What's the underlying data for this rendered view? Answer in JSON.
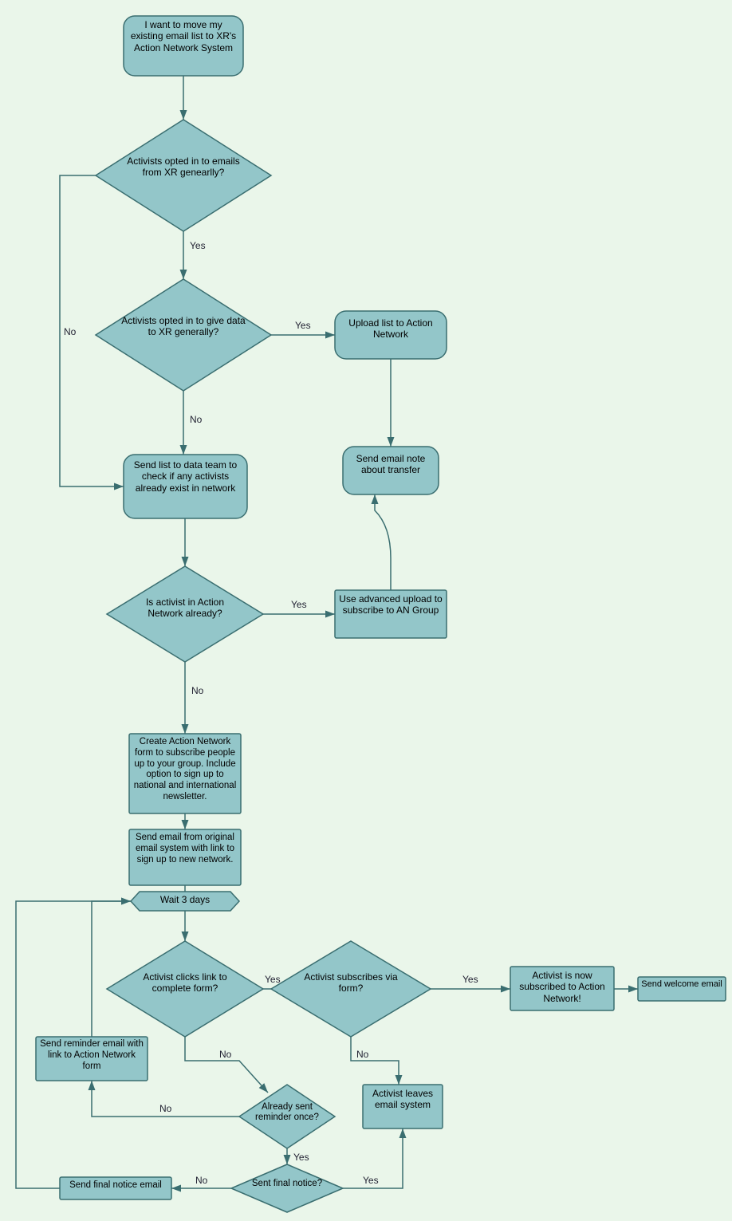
{
  "chart_data": {
    "type": "flowchart",
    "nodes": [
      {
        "id": "start",
        "shape": "rounded",
        "text": "I want to move my existing email list to XR's Action Network System"
      },
      {
        "id": "optedEmails",
        "shape": "diamond",
        "text": "Activists opted in to emails from XR genearlly?"
      },
      {
        "id": "optedData",
        "shape": "diamond",
        "text": "Activists opted in to give data to XR generally?"
      },
      {
        "id": "uploadList",
        "shape": "rounded",
        "text": "Upload list to Action Network"
      },
      {
        "id": "sendNote",
        "shape": "rounded",
        "text": "Send email note about transfer"
      },
      {
        "id": "sendDataTeam",
        "shape": "rounded",
        "text": "Send list to data team to check if any activists already exist in network"
      },
      {
        "id": "isInAN",
        "shape": "diamond",
        "text": "Is activist in Action Network already?"
      },
      {
        "id": "advUpload",
        "shape": "rect",
        "text": "Use advanced upload to subscribe to AN Group"
      },
      {
        "id": "createForm",
        "shape": "rect",
        "text": "Create Action Network form to subscribe people up to your group. Include option to sign up to national and international newsletter."
      },
      {
        "id": "sendEmail",
        "shape": "rect",
        "text": "Send email from original email system with link to sign up to new network."
      },
      {
        "id": "wait3",
        "shape": "hexagon",
        "text": "Wait 3 days"
      },
      {
        "id": "clicks",
        "shape": "diamond",
        "text": "Activist clicks link to complete form?"
      },
      {
        "id": "subscribes",
        "shape": "diamond",
        "text": "Activist subscribes via form?"
      },
      {
        "id": "nowSub",
        "shape": "rect",
        "text": "Activist is now subscribed to Action Network!"
      },
      {
        "id": "welcome",
        "shape": "rect",
        "text": "Send welcome email"
      },
      {
        "id": "reminder",
        "shape": "rect",
        "text": "Send reminder email with link to Action Network form"
      },
      {
        "id": "alreadySent",
        "shape": "diamond",
        "text": "Already sent reminder once?"
      },
      {
        "id": "leaves",
        "shape": "rect",
        "text": "Activist leaves email system"
      },
      {
        "id": "sendFinal",
        "shape": "rect",
        "text": "Send final notice email"
      },
      {
        "id": "sentFinal",
        "shape": "diamond",
        "text": "Sent final notice?"
      }
    ],
    "edges": [
      {
        "from": "start",
        "to": "optedEmails"
      },
      {
        "from": "optedEmails",
        "to": "optedData",
        "label": "Yes"
      },
      {
        "from": "optedEmails",
        "to": "sendDataTeam",
        "label": "No"
      },
      {
        "from": "optedData",
        "to": "uploadList",
        "label": "Yes"
      },
      {
        "from": "optedData",
        "to": "sendDataTeam",
        "label": "No"
      },
      {
        "from": "uploadList",
        "to": "sendNote"
      },
      {
        "from": "sendDataTeam",
        "to": "isInAN"
      },
      {
        "from": "isInAN",
        "to": "advUpload",
        "label": "Yes"
      },
      {
        "from": "advUpload",
        "to": "sendNote"
      },
      {
        "from": "isInAN",
        "to": "createForm",
        "label": "No"
      },
      {
        "from": "createForm",
        "to": "sendEmail"
      },
      {
        "from": "sendEmail",
        "to": "wait3"
      },
      {
        "from": "wait3",
        "to": "clicks"
      },
      {
        "from": "clicks",
        "to": "subscribes",
        "label": "Yes"
      },
      {
        "from": "clicks",
        "to": "alreadySent",
        "label": "No"
      },
      {
        "from": "subscribes",
        "to": "nowSub",
        "label": "Yes"
      },
      {
        "from": "subscribes",
        "to": "leaves",
        "label": "No"
      },
      {
        "from": "nowSub",
        "to": "welcome"
      },
      {
        "from": "alreadySent",
        "to": "reminder",
        "label": "No"
      },
      {
        "from": "reminder",
        "to": "wait3"
      },
      {
        "from": "alreadySent",
        "to": "sentFinal",
        "label": "Yes"
      },
      {
        "from": "sentFinal",
        "to": "sendFinal",
        "label": "No"
      },
      {
        "from": "sendFinal",
        "to": "wait3"
      },
      {
        "from": "sentFinal",
        "to": "leaves",
        "label": "Yes"
      }
    ]
  },
  "labels": {
    "yes": "Yes",
    "no": "No"
  },
  "n": {
    "start": "I want to move my existing email list to XR's Action Network System",
    "optedEmails": "Activists opted in to emails from XR genearlly?",
    "optedData": "Activists opted in to give data to XR generally?",
    "uploadList": "Upload list to Action Network",
    "sendNote": "Send email note about transfer",
    "sendDataTeam": "Send list to data team to check if any activists already exist in network",
    "isInAN": "Is activist in Action Network already?",
    "advUpload": "Use advanced upload to subscribe to AN Group",
    "createForm": "Create Action Network form to subscribe people up to your group. Include option to sign up to national and international newsletter.",
    "sendEmail": "Send email from original email system with link to sign up to new network.",
    "wait3": "Wait 3 days",
    "clicks": "Activist clicks link to complete form?",
    "subscribes": "Activist subscribes via form?",
    "nowSub": "Activist is now subscribed to Action Network!",
    "welcome": "Send welcome email",
    "reminder": "Send reminder email with link to Action Network form",
    "alreadySent": "Already sent reminder once?",
    "leaves": "Activist leaves email system",
    "sendFinal": "Send final notice email",
    "sentFinal": "Sent final notice?"
  }
}
